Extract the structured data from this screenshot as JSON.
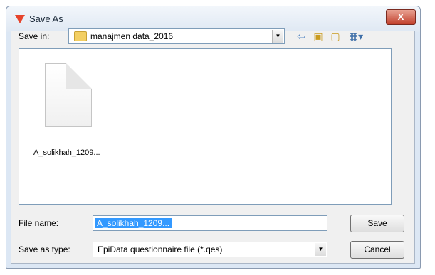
{
  "window": {
    "title": "Save As",
    "close_label": "X"
  },
  "save_in": {
    "label": "Save in:",
    "value": "manajmen data_2016"
  },
  "toolbar": {
    "back": "⇦",
    "up_folder": "▣",
    "new_folder": "▢",
    "views": "▦▾"
  },
  "files": [
    {
      "name": "A_solikhah_1209..."
    }
  ],
  "file_name": {
    "label": "File name:",
    "value": "A_solikhah_1209..."
  },
  "save_as_type": {
    "label": "Save as type:",
    "value": "EpiData questionnaire file (*.qes)"
  },
  "buttons": {
    "save": "Save",
    "cancel": "Cancel"
  },
  "combo_arrow": "▼"
}
